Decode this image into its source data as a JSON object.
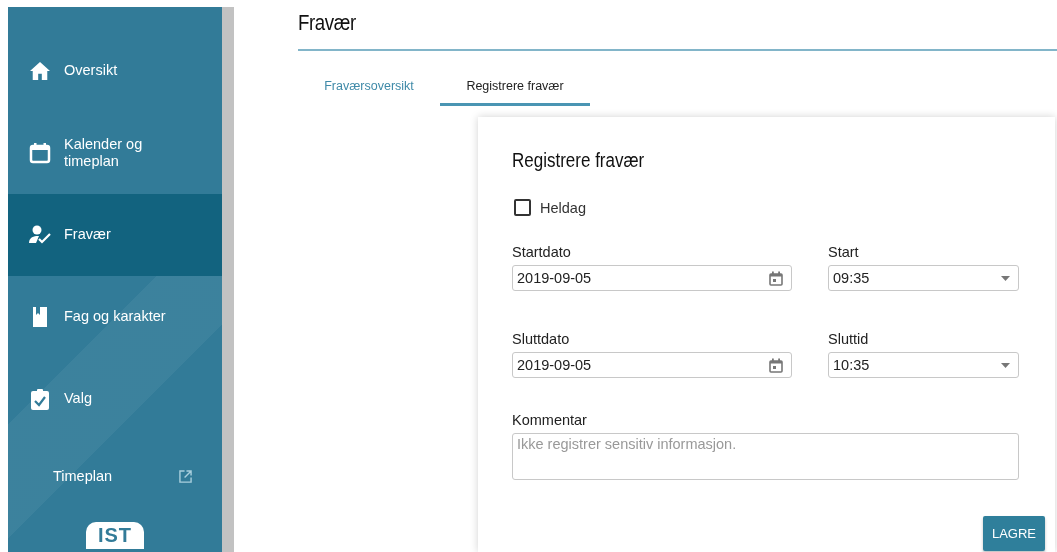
{
  "sidebar": {
    "items": [
      {
        "label": "Oversikt",
        "selected": false
      },
      {
        "label": "Kalender og timeplan",
        "selected": false
      },
      {
        "label": "Fravær",
        "selected": true
      },
      {
        "label": "Fag og karakter",
        "selected": false
      },
      {
        "label": "Valg",
        "selected": false
      }
    ],
    "link": {
      "label": "Timeplan"
    },
    "logo": "IST"
  },
  "page": {
    "title": "Fravær"
  },
  "tabs": [
    {
      "label": "Fraværsoversikt",
      "selected": false
    },
    {
      "label": "Registrere fravær",
      "selected": true
    }
  ],
  "form": {
    "title": "Registrere fravær",
    "checkbox": {
      "label": "Heldag",
      "checked": false
    },
    "fields": [
      {
        "kind": "date",
        "label": "Startdato",
        "value": "2019-09-05"
      },
      {
        "kind": "select",
        "label": "Start",
        "value": "09:35"
      },
      {
        "kind": "date",
        "label": "Sluttdato",
        "value": "2019-09-05"
      },
      {
        "kind": "select",
        "label": "Sluttid",
        "value": "10:35"
      }
    ],
    "comment": {
      "label": "Kommentar",
      "placeholder": "Ikke registrer sensitiv informasjon."
    },
    "submit": "LAGRE"
  }
}
